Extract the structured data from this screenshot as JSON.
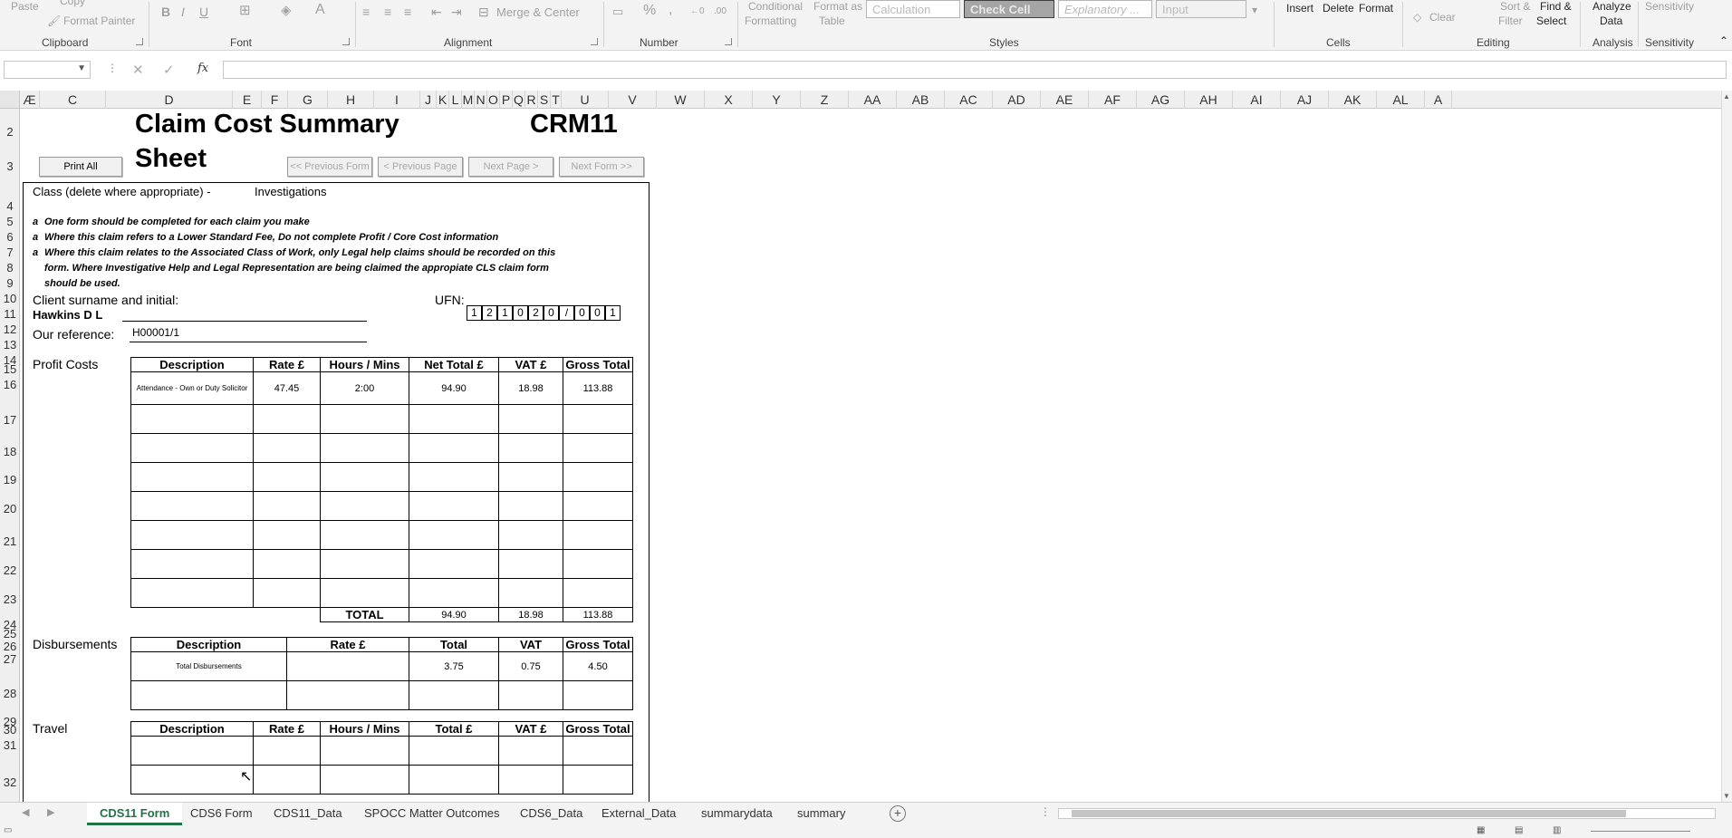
{
  "ribbon": {
    "clipboard": {
      "paste": "Paste",
      "copy": "Copy",
      "format_painter": "Format Painter",
      "label": "Clipboard"
    },
    "font": {
      "bold": "B",
      "italic": "I",
      "underline": "U",
      "label": "Font"
    },
    "alignment": {
      "merge_center": "Merge & Center",
      "label": "Alignment"
    },
    "number": {
      "percent": "%",
      "comma": ",",
      "label": "Number"
    },
    "styles": {
      "conditional": "Conditional",
      "formatting": "Formatting",
      "format_as": "Format as",
      "table": "Table",
      "calculation": "Calculation",
      "check_cell": "Check Cell",
      "explanatory": "Explanatory ...",
      "input": "Input",
      "label": "Styles"
    },
    "cells": {
      "insert": "Insert",
      "delete": "Delete",
      "format": "Format",
      "label": "Cells"
    },
    "editing": {
      "clear": "Clear",
      "sort_filter_1": "Sort &",
      "sort_filter_2": "Filter",
      "find_select_1": "Find &",
      "find_select_2": "Select",
      "label": "Editing"
    },
    "analysis": {
      "analyze_1": "Analyze",
      "analyze_2": "Data",
      "label": "Analysis"
    },
    "sensitivity": {
      "sensitivity": "Sensitivity",
      "label": "Sensitivity"
    }
  },
  "formula_bar": {
    "name_box": "",
    "fx": "fx",
    "value": ""
  },
  "columns": [
    "Æ",
    "C",
    "D",
    "E",
    "F",
    "G",
    "H",
    "I",
    "J",
    "K",
    "L",
    "M",
    "N",
    "O",
    "P",
    "Q",
    "R",
    "S",
    "T",
    "U",
    "V",
    "W",
    "X",
    "Y",
    "Z",
    "AA",
    "AB",
    "AC",
    "AD",
    "AE",
    "AF",
    "AG",
    "AH",
    "AI",
    "AJ",
    "AK",
    "AL",
    "A"
  ],
  "rows": [
    "2",
    "3",
    "4",
    "5",
    "6",
    "7",
    "8",
    "9",
    "10",
    "11",
    "12",
    "13",
    "14",
    "15",
    "16",
    "17",
    "18",
    "19",
    "20",
    "21",
    "22",
    "23",
    "24",
    "25",
    "26",
    "27",
    "28",
    "29",
    "30",
    "31",
    "32"
  ],
  "sheet": {
    "title": "Claim Cost Summary",
    "title2": "Sheet",
    "form_code": "CRM11",
    "buttons": {
      "print_all": "Print All",
      "prev_form": "<< Previous Form",
      "prev_page": "< Previous Page",
      "next_page": "Next Page >",
      "next_form": "Next Form >>"
    },
    "class_label": "Class (delete where appropriate) -",
    "class_value": "Investigations",
    "notes": [
      {
        "bullet": "a",
        "text": "One form should be completed for each claim you make"
      },
      {
        "bullet": "a",
        "text": "Where this claim refers to a Lower Standard Fee, Do not complete Profit / Core Cost information"
      },
      {
        "bullet": "a",
        "text": "Where this claim relates to the Associated Class of Work, only Legal help claims should be recorded on this"
      },
      {
        "bullet": "",
        "text": "form.  Where Investigative Help and Legal Representation are being claimed the appropiate CLS claim form"
      },
      {
        "bullet": "",
        "text": "should be used."
      }
    ],
    "client_label": "Client surname and initial:",
    "client_value": "Hawkins D L",
    "ufn_label": "UFN:",
    "ufn_digits": [
      "1",
      "2",
      "1",
      "0",
      "2",
      "0",
      "/",
      "0",
      "0",
      "1"
    ],
    "ref_label": "Our reference:",
    "ref_value": "H00001/1",
    "profit": {
      "label": "Profit Costs",
      "headers": [
        "Description",
        "Rate £",
        "Hours / Mins",
        "Net Total £",
        "VAT £",
        "Gross Total"
      ],
      "rows": [
        [
          "Attendance - Own or Duty Solicitor",
          "47.45",
          "2:00",
          "94.90",
          "18.98",
          "113.88"
        ],
        [
          "",
          "",
          "",
          "",
          "",
          ""
        ],
        [
          "",
          "",
          "",
          "",
          "",
          ""
        ],
        [
          "",
          "",
          "",
          "",
          "",
          ""
        ],
        [
          "",
          "",
          "",
          "",
          "",
          ""
        ],
        [
          "",
          "",
          "",
          "",
          "",
          ""
        ],
        [
          "",
          "",
          "",
          "",
          "",
          ""
        ],
        [
          "",
          "",
          "",
          "",
          "",
          ""
        ]
      ],
      "total_label": "TOTAL",
      "totals": [
        "94.90",
        "18.98",
        "113.88"
      ]
    },
    "disb": {
      "label": "Disbursements",
      "headers": [
        "Description",
        "Rate £",
        "Total",
        "VAT",
        "Gross Total"
      ],
      "rows": [
        [
          "Total Disbursements",
          "",
          "3.75",
          "0.75",
          "4.50"
        ],
        [
          "",
          "",
          "",
          "",
          ""
        ]
      ]
    },
    "travel": {
      "label": "Travel",
      "headers": [
        "Description",
        "Rate £",
        "Hours / Mins",
        "Total £",
        "VAT £",
        "Gross Total"
      ],
      "rows": [
        [
          "",
          "",
          "",
          "",
          "",
          ""
        ],
        [
          "",
          "",
          "",
          "",
          "",
          ""
        ]
      ]
    }
  },
  "tabs": [
    "CDS11 Form",
    "CDS6 Form",
    "CDS11_Data",
    "SPOCC Matter Outcomes",
    "CDS6_Data",
    "External_Data",
    "summarydata",
    "summary"
  ]
}
